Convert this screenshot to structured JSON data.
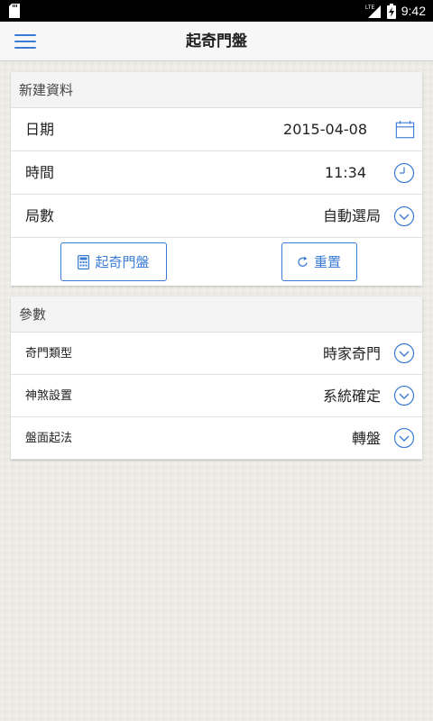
{
  "status_bar": {
    "time": "9:42",
    "network": "LTE"
  },
  "app_bar": {
    "title": "起奇門盤",
    "menu_icon": "hamburger-menu-icon"
  },
  "new_data": {
    "header": "新建資料",
    "date": {
      "label": "日期",
      "value": "2015-04-08"
    },
    "time": {
      "label": "時間",
      "value": "11:34"
    },
    "ju": {
      "label": "局數",
      "value": "自動選局"
    },
    "calc_button": "起奇門盤",
    "reset_button": "重置"
  },
  "params": {
    "header": "參數",
    "rows": [
      {
        "label": "奇門類型",
        "value": "時家奇門"
      },
      {
        "label": "神煞設置",
        "value": "系統確定"
      },
      {
        "label": "盤面起法",
        "value": "轉盤"
      }
    ]
  },
  "colors": {
    "accent": "#3a7bd5",
    "app_bar": "#f7f7f7",
    "background": "#ecebe6"
  }
}
